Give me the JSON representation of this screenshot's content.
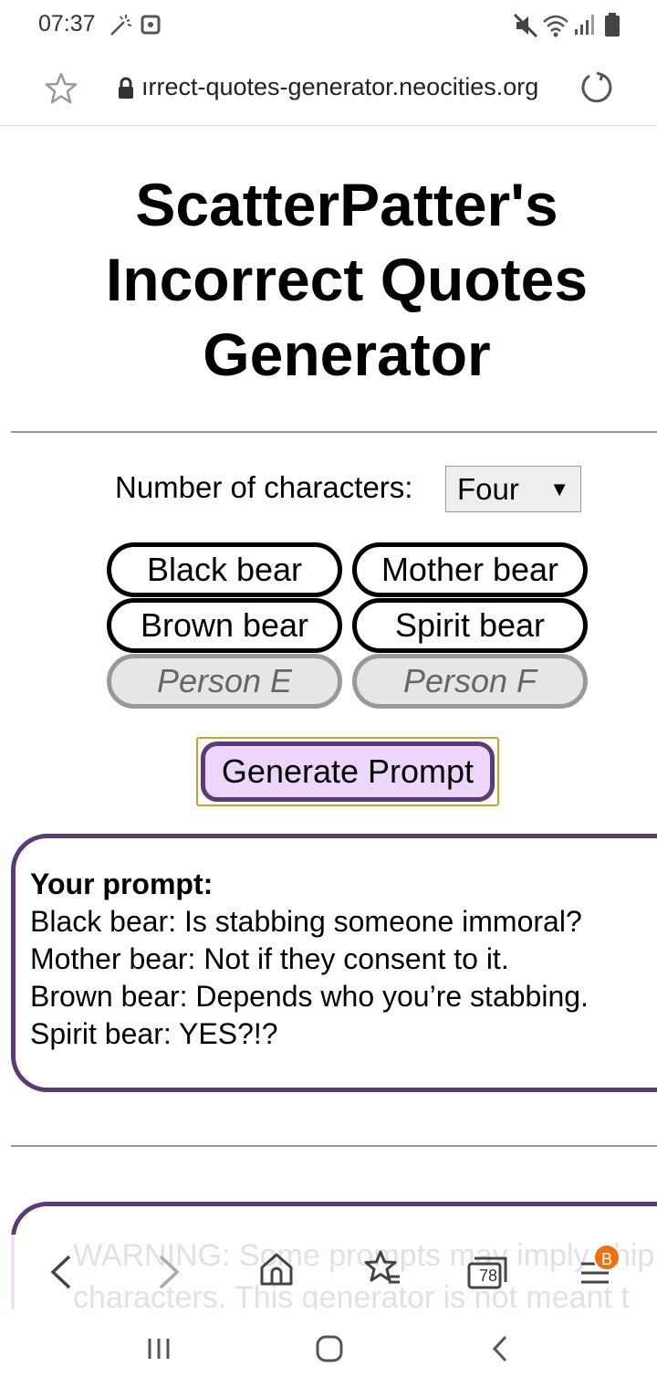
{
  "status_bar": {
    "time": "07:37",
    "icons": [
      "magic-wand-icon",
      "screen-record-icon",
      "mute-icon",
      "wifi-icon",
      "signal-icon",
      "battery-icon"
    ]
  },
  "url_bar": {
    "url": "ırrect-quotes-generator.neocities.org"
  },
  "page": {
    "title": "ScatterPatter's Incorrect Quotes Generator",
    "count_label": "Number of characters:",
    "count_value": "Four",
    "characters": [
      {
        "name": "Black bear",
        "filled": true
      },
      {
        "name": "Mother bear",
        "filled": true
      },
      {
        "name": "Brown bear",
        "filled": true
      },
      {
        "name": "Spirit bear",
        "filled": true
      },
      {
        "name": "Person E",
        "filled": false
      },
      {
        "name": "Person F",
        "filled": false
      }
    ],
    "generate_button": "Generate Prompt",
    "prompt_heading": "Your prompt:",
    "prompt_lines": [
      "Black bear: Is stabbing someone immoral?",
      "Mother bear: Not if they consent to it.",
      "Brown bear: Depends who you’re stabbing.",
      "Spirit bear: YES?!?"
    ],
    "warning_ghost": "WARNING: Some prompts may imply ship",
    "warning_ghost2": "characters. This generator is not meant t"
  },
  "toolbar": {
    "tab_count": "78",
    "menu_badge": "B",
    "badge_color": "#f07010"
  },
  "colors": {
    "accent_purple": "#5a3a78",
    "button_fill": "#ecd6fb",
    "focus_ring": "#d4a020"
  }
}
